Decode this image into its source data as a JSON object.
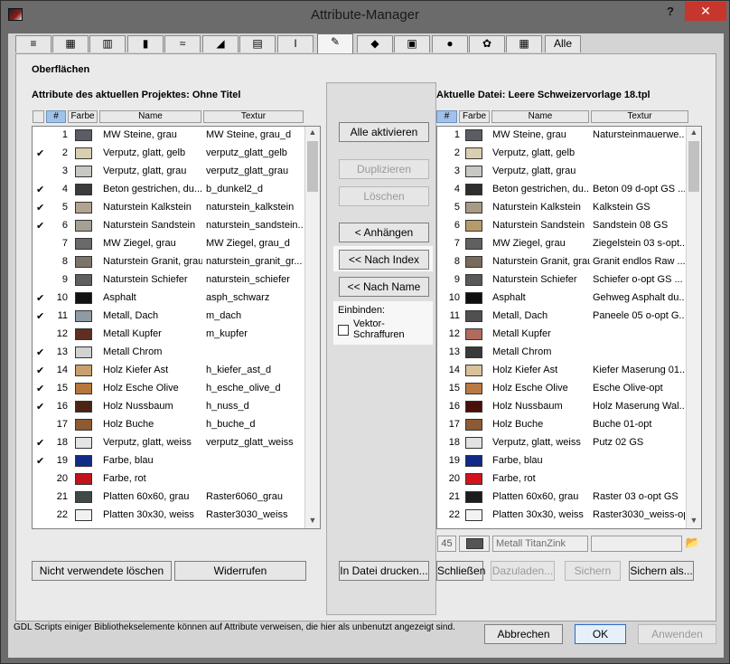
{
  "window": {
    "title": "Attribute-Manager",
    "help": "?",
    "close": "✕"
  },
  "tabs": [
    {
      "icon": "pens-icon",
      "glyph": "≡",
      "label": ""
    },
    {
      "icon": "fills-icon",
      "glyph": "▦",
      "label": ""
    },
    {
      "icon": "line-types-icon",
      "glyph": "▥",
      "label": ""
    },
    {
      "icon": "building-materials-icon",
      "glyph": "▮",
      "label": ""
    },
    {
      "icon": "composites-icon",
      "glyph": "≈",
      "label": ""
    },
    {
      "icon": "profiles-icon",
      "glyph": "◢",
      "label": ""
    },
    {
      "icon": "zones-icon",
      "glyph": "▤",
      "label": ""
    },
    {
      "icon": "operation-profiles-icon",
      "glyph": "I",
      "label": ""
    },
    {
      "icon": "surfaces-icon",
      "glyph": "✎",
      "label": ""
    },
    {
      "icon": "layers-icon",
      "glyph": "◆",
      "label": ""
    },
    {
      "icon": "layer-combinations-icon",
      "glyph": "▣",
      "label": ""
    },
    {
      "icon": "model-view-options-icon",
      "glyph": "●",
      "label": ""
    },
    {
      "icon": "markup-styles-icon",
      "glyph": "✿",
      "label": ""
    },
    {
      "icon": "mep-systems-icon",
      "glyph": "▦",
      "label": ""
    },
    {
      "icon": "",
      "glyph": "",
      "label": "Alle"
    }
  ],
  "section_title": "Oberflächen",
  "left": {
    "heading": "Attribute des aktuellen Projektes: Ohne Titel",
    "columns": {
      "num": "#",
      "color": "Farbe",
      "name": "Name",
      "texture": "Textur"
    },
    "rows": [
      {
        "check": "",
        "num": "1",
        "color": "#5a5d63",
        "name": "MW Steine, grau",
        "texture": "MW Steine, grau_d"
      },
      {
        "check": "✔",
        "num": "2",
        "color": "#d9cfb0",
        "name": "Verputz, glatt, gelb",
        "texture": "verputz_glatt_gelb"
      },
      {
        "check": "",
        "num": "3",
        "color": "#c9c7c1",
        "name": "Verputz, glatt, grau",
        "texture": "verputz_glatt_grau"
      },
      {
        "check": "✔",
        "num": "4",
        "color": "#3b3b3b",
        "name": "Beton gestrichen, du...",
        "texture": "b_dunkel2_d"
      },
      {
        "check": "✔",
        "num": "5",
        "color": "#b1a391",
        "name": "Naturstein Kalkstein",
        "texture": "naturstein_kalkstein"
      },
      {
        "check": "✔",
        "num": "6",
        "color": "#a59f95",
        "name": "Naturstein Sandstein",
        "texture": "naturstein_sandstein..."
      },
      {
        "check": "",
        "num": "7",
        "color": "#6a6a6a",
        "name": "MW Ziegel, grau",
        "texture": "MW Ziegel, grau_d"
      },
      {
        "check": "",
        "num": "8",
        "color": "#7d7469",
        "name": "Naturstein Granit, grau",
        "texture": "naturstein_granit_gr..."
      },
      {
        "check": "",
        "num": "9",
        "color": "#5f5f5f",
        "name": "Naturstein Schiefer",
        "texture": "naturstein_schiefer"
      },
      {
        "check": "✔",
        "num": "10",
        "color": "#121212",
        "name": "Asphalt",
        "texture": "asph_schwarz"
      },
      {
        "check": "✔",
        "num": "11",
        "color": "#8f9aa2",
        "name": "Metall, Dach",
        "texture": "m_dach"
      },
      {
        "check": "",
        "num": "12",
        "color": "#5e2f22",
        "name": "Metall Kupfer",
        "texture": "m_kupfer"
      },
      {
        "check": "✔",
        "num": "13",
        "color": "#d2d2d2",
        "name": "Metall Chrom",
        "texture": ""
      },
      {
        "check": "✔",
        "num": "14",
        "color": "#c8a06e",
        "name": "Holz Kiefer Ast",
        "texture": "h_kiefer_ast_d"
      },
      {
        "check": "✔",
        "num": "15",
        "color": "#b5773c",
        "name": "Holz Esche Olive",
        "texture": "h_esche_olive_d"
      },
      {
        "check": "✔",
        "num": "16",
        "color": "#4a2513",
        "name": "Holz Nussbaum",
        "texture": "h_nuss_d"
      },
      {
        "check": "",
        "num": "17",
        "color": "#8c5a33",
        "name": "Holz Buche",
        "texture": "h_buche_d"
      },
      {
        "check": "✔",
        "num": "18",
        "color": "#e4e4e4",
        "name": "Verputz, glatt, weiss",
        "texture": "verputz_glatt_weiss"
      },
      {
        "check": "✔",
        "num": "19",
        "color": "#102c86",
        "name": "Farbe, blau",
        "texture": ""
      },
      {
        "check": "",
        "num": "20",
        "color": "#c0131b",
        "name": "Farbe, rot",
        "texture": ""
      },
      {
        "check": "",
        "num": "21",
        "color": "#3f4a48",
        "name": "Platten 60x60, grau",
        "texture": "Raster6060_grau"
      },
      {
        "check": "",
        "num": "22",
        "color": "#f1f1f1",
        "name": "Platten 30x30, weiss",
        "texture": "Raster3030_weiss"
      }
    ],
    "btn_delete_unused": "Nicht verwendete löschen",
    "btn_undo": "Widerrufen"
  },
  "middle": {
    "btn_activate_all": "Alle aktivieren",
    "btn_duplicate": "Duplizieren",
    "btn_delete": "Löschen",
    "btn_append": "< Anhängen",
    "btn_by_index": "<< Nach Index",
    "btn_by_name": "<< Nach Name",
    "include_label": "Einbinden:",
    "vector_hatch": "Vektor-\nSchraffuren",
    "btn_print": "In Datei drucken..."
  },
  "right": {
    "heading": "Aktuelle Datei: Leere Schweizervorlage 18.tpl",
    "columns": {
      "num": "#",
      "color": "Farbe",
      "name": "Name",
      "texture": "Textur"
    },
    "rows": [
      {
        "num": "1",
        "color": "#5a5d63",
        "name": "MW Steine, grau",
        "texture": "Natursteinmauerwe..."
      },
      {
        "num": "2",
        "color": "#d9cfb0",
        "name": "Verputz, glatt, gelb",
        "texture": ""
      },
      {
        "num": "3",
        "color": "#c9c7c1",
        "name": "Verputz, glatt, grau",
        "texture": ""
      },
      {
        "num": "4",
        "color": "#2e2e2e",
        "name": "Beton gestrichen, du...",
        "texture": "Beton 09 d-opt GS ..."
      },
      {
        "num": "5",
        "color": "#a99a86",
        "name": "Naturstein Kalkstein",
        "texture": "Kalkstein GS"
      },
      {
        "num": "6",
        "color": "#b69b6a",
        "name": "Naturstein Sandstein",
        "texture": "Sandstein 08 GS"
      },
      {
        "num": "7",
        "color": "#606060",
        "name": "MW Ziegel, grau",
        "texture": "Ziegelstein 03 s-opt..."
      },
      {
        "num": "8",
        "color": "#7a6a59",
        "name": "Naturstein Granit, grau",
        "texture": "Granit endlos Raw ..."
      },
      {
        "num": "9",
        "color": "#595959",
        "name": "Naturstein Schiefer",
        "texture": "Schiefer o-opt GS ..."
      },
      {
        "num": "10",
        "color": "#0f0f0f",
        "name": "Asphalt",
        "texture": "Gehweg Asphalt du..."
      },
      {
        "num": "11",
        "color": "#505050",
        "name": "Metall, Dach",
        "texture": "Paneele 05 o-opt G..."
      },
      {
        "num": "12",
        "color": "#b06b5e",
        "name": "Metall Kupfer",
        "texture": ""
      },
      {
        "num": "13",
        "color": "#3a3a3a",
        "name": "Metall Chrom",
        "texture": ""
      },
      {
        "num": "14",
        "color": "#d9c19a",
        "name": "Holz Kiefer Ast",
        "texture": "Kiefer Maserung 01..."
      },
      {
        "num": "15",
        "color": "#b87a45",
        "name": "Holz Esche Olive",
        "texture": "Esche Olive-opt"
      },
      {
        "num": "16",
        "color": "#4a0e0b",
        "name": "Holz Nussbaum",
        "texture": "Holz Maserung Wal..."
      },
      {
        "num": "17",
        "color": "#8d5a36",
        "name": "Holz Buche",
        "texture": "Buche 01-opt"
      },
      {
        "num": "18",
        "color": "#e2e2e2",
        "name": "Verputz, glatt, weiss",
        "texture": "Putz 02 GS"
      },
      {
        "num": "19",
        "color": "#0f2a8a",
        "name": "Farbe, blau",
        "texture": ""
      },
      {
        "num": "20",
        "color": "#d3121b",
        "name": "Farbe, rot",
        "texture": ""
      },
      {
        "num": "21",
        "color": "#1c1c1c",
        "name": "Platten 60x60, grau",
        "texture": "Raster 03 o-opt GS"
      },
      {
        "num": "22",
        "color": "#f3f3f3",
        "name": "Platten 30x30, weiss",
        "texture": "Raster3030_weiss-opt"
      }
    ],
    "edit_row": {
      "num": "45",
      "color": "#555555",
      "name": "Metall TitanZink",
      "texture": ""
    },
    "btn_close": "Schließen",
    "btn_load": "Dazuladen...",
    "btn_save": "Sichern",
    "btn_save_as": "Sichern als..."
  },
  "footer": {
    "info": "GDL Scripts einiger Bibliothekselemente können auf Attribute verweisen, die hier als unbenutzt angezeigt sind.",
    "btn_cancel": "Abbrechen",
    "btn_ok": "OK",
    "btn_apply": "Anwenden"
  }
}
